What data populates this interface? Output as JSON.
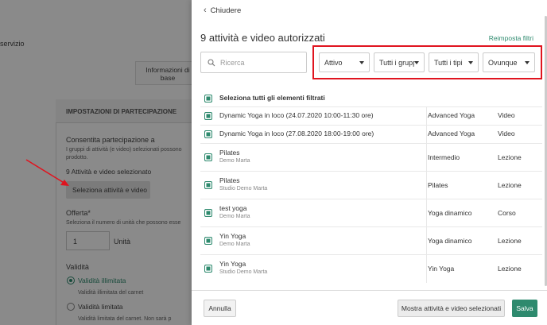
{
  "background": {
    "servizio_text": "servizio",
    "info_button": "Informazioni di base",
    "section_title": "IMPOSTAZIONI DI PARTECIPAZIONE",
    "consent_title": "Consentita partecipazione a",
    "consent_desc_1": "I gruppi di attività (e video) selezionati possono",
    "consent_desc_2": "prodotto.",
    "selected_count": "9 Attività e video selezionato",
    "select_button": "Seleziona attività e video",
    "offer_label": "Offerta*",
    "offer_desc": "Seleziona il numero di unità che possono esse",
    "units_value": "1",
    "units_label": "Unità",
    "validity_label": "Validità",
    "unlimited_label": "Validità illimitata",
    "unlimited_desc": "Validità illimitata del carnet",
    "limited_label": "Validità limitata",
    "limited_desc": "Validità limitata del carnet. Non sarà p"
  },
  "drawer": {
    "close_label": "Chiudere",
    "title": "9 attività e video autorizzati",
    "reset_label": "Reimposta filtri",
    "search_placeholder": "Ricerca",
    "filters": [
      "Attivo",
      "Tutti i gruppi",
      "Tutti i tipi",
      "Ovunque"
    ],
    "select_all_label": "Seleziona tutti gli elementi filtrati",
    "items": [
      {
        "name": "Dynamic Yoga in loco (24.07.2020 10:00-11:30 ore)",
        "sub": "",
        "category": "Advanced Yoga",
        "type": "Video"
      },
      {
        "name": "Dynamic Yoga in loco (27.08.2020 18:00-19:00 ore)",
        "sub": "",
        "category": "Advanced Yoga",
        "type": "Video"
      },
      {
        "name": "Pilates",
        "sub": "Demo Marta",
        "category": "Intermedio",
        "type": "Lezione"
      },
      {
        "name": "Pilates",
        "sub": "Studio Demo Marta",
        "category": "Pilates",
        "type": "Lezione"
      },
      {
        "name": "test yoga",
        "sub": "Demo Marta",
        "category": "Yoga dinamico",
        "type": "Corso"
      },
      {
        "name": "Yin Yoga",
        "sub": "Demo Marta",
        "category": "Yoga dinamico",
        "type": "Lezione"
      },
      {
        "name": "Yin Yoga",
        "sub": "Studio Demo Marta",
        "category": "Yin Yoga",
        "type": "Lezione"
      }
    ],
    "footer": {
      "cancel_label": "Annulla",
      "show_selected_label": "Mostra attività e video selezionati",
      "save_label": "Salva"
    }
  },
  "colors": {
    "accent": "#2e8a6e",
    "highlight": "#e0141f"
  }
}
